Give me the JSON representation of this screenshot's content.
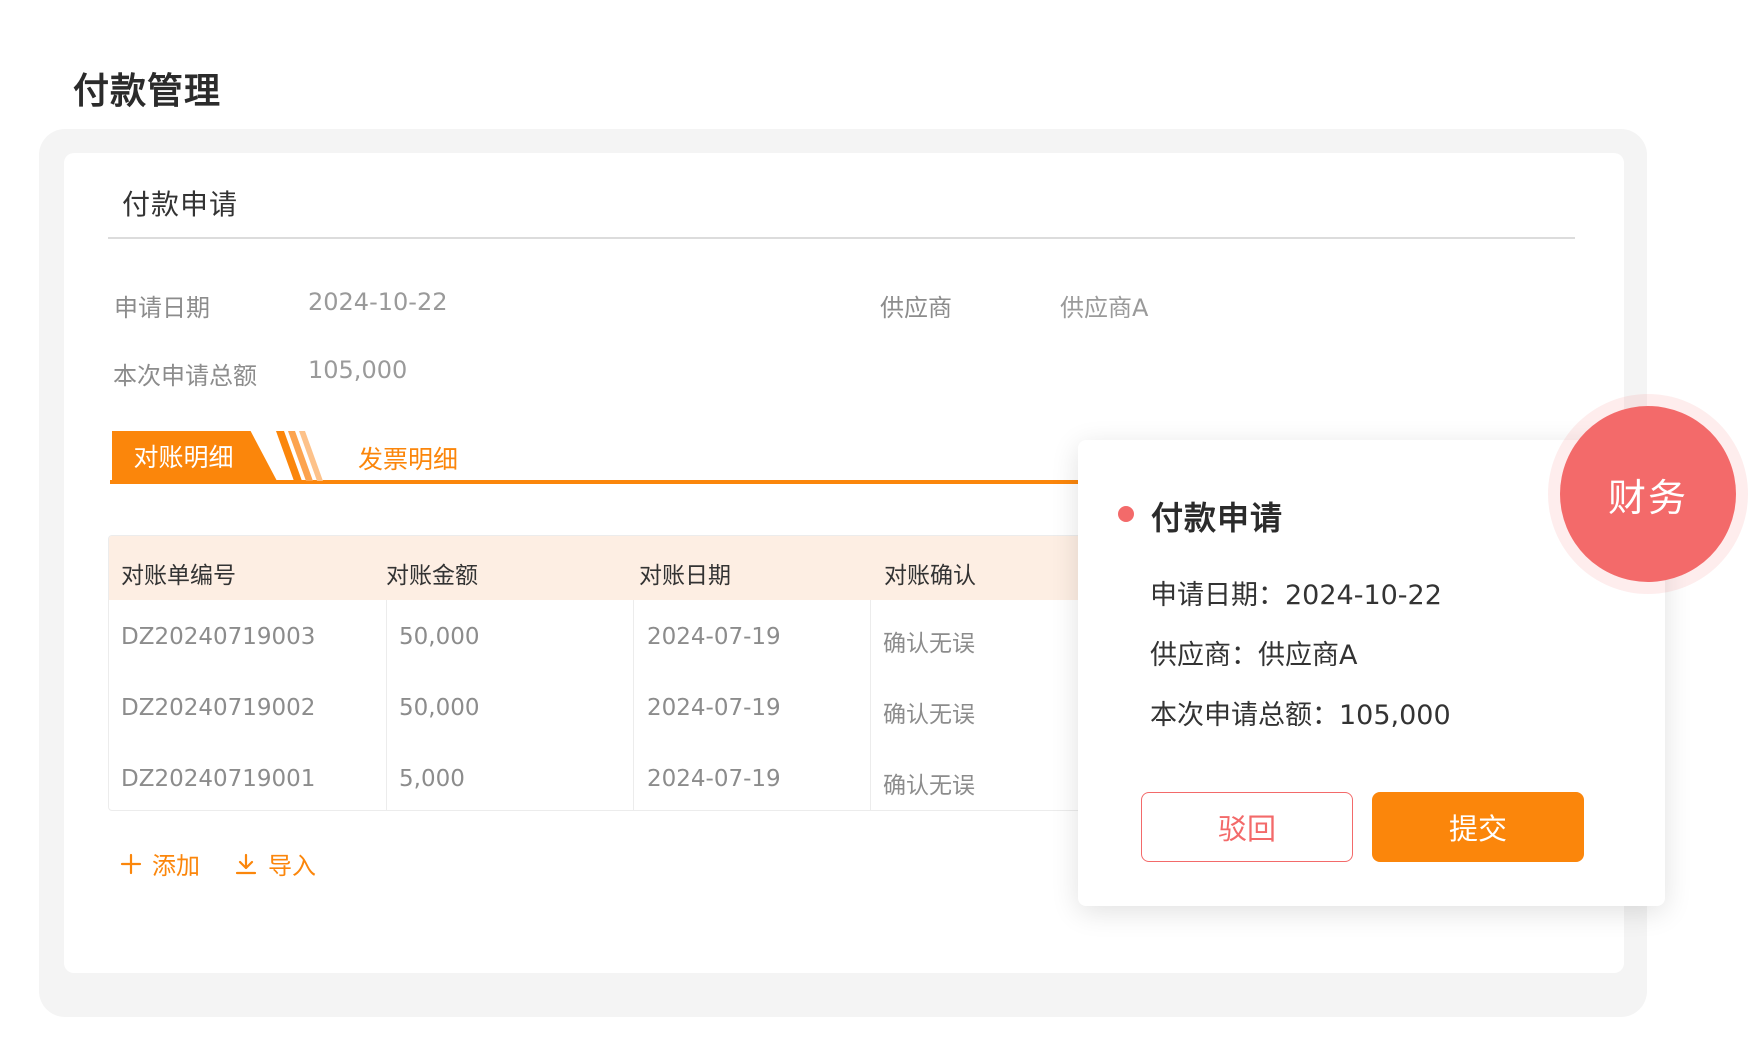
{
  "page": {
    "title": "付款管理"
  },
  "card": {
    "title": "付款申请",
    "fields": {
      "apply_date_label": "申请日期",
      "apply_date_value": "2024-10-22",
      "supplier_label": "供应商",
      "supplier_value": "供应商A",
      "total_label": "本次申请总额",
      "total_value": "105,000"
    }
  },
  "tabs": [
    {
      "label": "对账明细",
      "active": true
    },
    {
      "label": "发票明细",
      "active": false
    }
  ],
  "table": {
    "columns": [
      "对账单编号",
      "对账金额",
      "对账日期",
      "对账确认"
    ],
    "rows": [
      [
        "DZ20240719003",
        "50,000",
        "2024-07-19",
        "确认无误"
      ],
      [
        "DZ20240719002",
        "50,000",
        "2024-07-19",
        "确认无误"
      ],
      [
        "DZ20240719001",
        "5,000",
        "2024-07-19",
        "确认无误"
      ]
    ]
  },
  "actions": {
    "add_label": "添加",
    "import_label": "导入"
  },
  "popup": {
    "title": "付款申请",
    "line1": "申请日期：2024-10-22",
    "line2": "供应商：供应商A",
    "line3": "本次申请总额：105,000",
    "reject_label": "驳回",
    "submit_label": "提交"
  },
  "role_badge": "财务",
  "colors": {
    "accent": "#fb860b",
    "danger": "#f36a6a",
    "table_header_bg": "#fdeee3"
  }
}
